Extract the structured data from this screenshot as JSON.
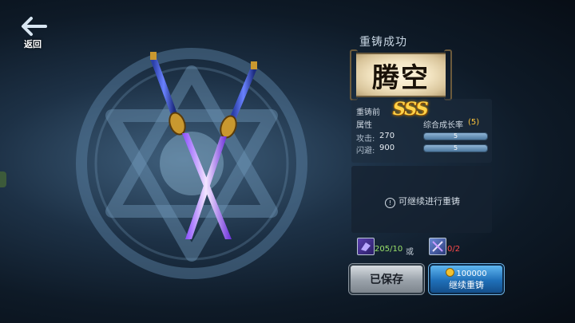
{
  "header": {
    "back_label": "返回"
  },
  "result": {
    "title": "重铸成功",
    "weapon_name": "腾空"
  },
  "stats": {
    "before_label": "重铸前",
    "grade": "SSS",
    "attr_label": "属性",
    "growth_label": "综合成长率",
    "growth_value": "(5)",
    "rows": [
      {
        "label": "攻击:",
        "value": "270",
        "bar_value": "5",
        "bar_level": 1.0
      },
      {
        "label": "闪避:",
        "value": "900",
        "bar_value": "5",
        "bar_level": 1.0
      }
    ]
  },
  "hint": {
    "text": "可继续进行重铸",
    "icon": "exclamation-circle-icon"
  },
  "materials": [
    {
      "icon": "reforge-stone-icon",
      "count": "205/10",
      "color": "#9be36a"
    },
    {
      "separator": "或"
    },
    {
      "icon": "reforge-scroll-icon",
      "count": "0/2",
      "color": "#ff4a4a"
    }
  ],
  "buttons": {
    "saved_label": "已保存",
    "reforge_cost": "100000",
    "reforge_label": "继续重铸"
  },
  "colors": {
    "accent_gold": "#ffd44a",
    "button_blue": "#1f6fb8",
    "have_enough": "#9be36a",
    "not_enough": "#ff4a4a"
  }
}
